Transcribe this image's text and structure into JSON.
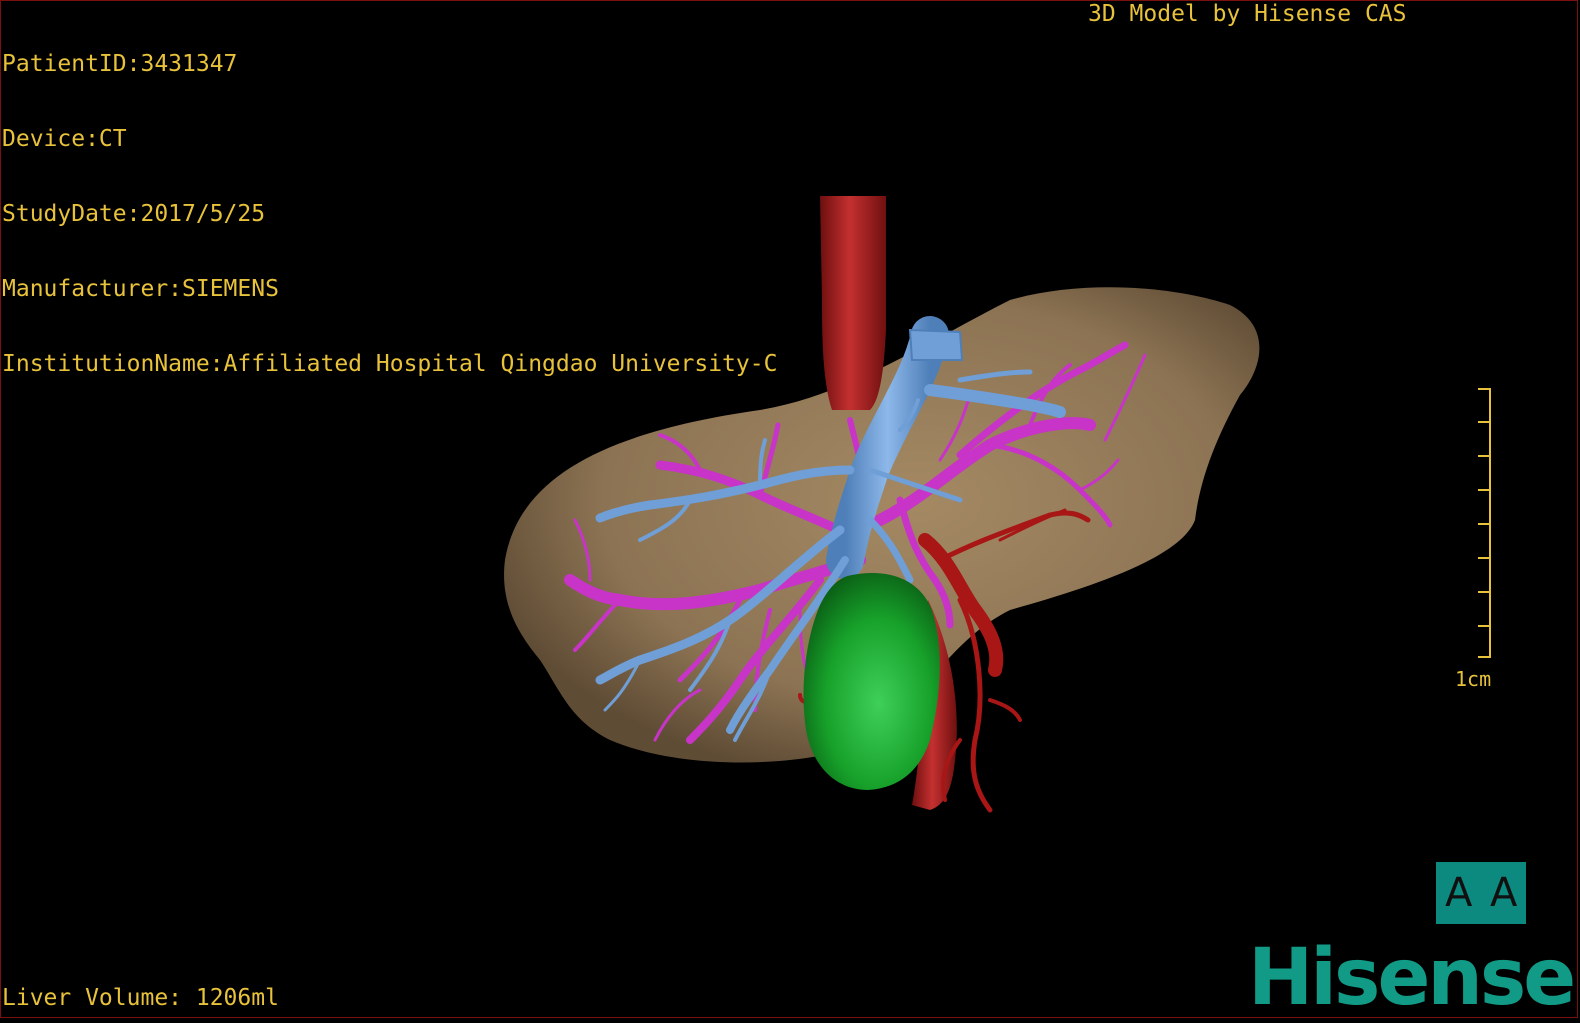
{
  "overlay": {
    "patient_id": "PatientID:3431347",
    "device": "Device:CT",
    "study_date": "StudyDate:2017/5/25",
    "manufacturer": "Manufacturer:SIEMENS",
    "institution": "InstitutionName:Affiliated Hospital Qingdao University-C",
    "credit": "3D Model by Hisense CAS",
    "liver_volume": "Liver Volume: 1206ml",
    "scale_label": "1cm"
  },
  "orientation_cube": {
    "left_glyph": "A",
    "right_glyph": "A"
  },
  "logo": {
    "text": "Hisense"
  },
  "colors": {
    "overlay_text": "#e8c23a",
    "liver": "#8c7353",
    "aorta": "#b01c1c",
    "portal_vein": "#6f9fd6",
    "hepatic_vein": "#c833c8",
    "tumor": "#19a52a",
    "brand": "#119a86"
  }
}
